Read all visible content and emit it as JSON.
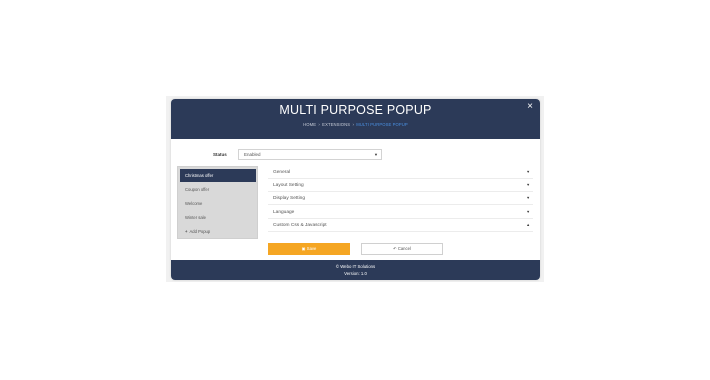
{
  "header": {
    "title": "MULTI PURPOSE POPUP",
    "breadcrumb": [
      "HOME",
      "EXTENSIONS",
      "MULTI PURPOSE POPUP"
    ],
    "close_icon": "×"
  },
  "status": {
    "label": "Status",
    "value": "Enabled",
    "arrow": "▼"
  },
  "sidebar": {
    "items": [
      {
        "label": "Christmas offer",
        "active": true
      },
      {
        "label": "Coupon offer",
        "active": false
      },
      {
        "label": "Welcome",
        "active": false
      },
      {
        "label": "Winter sale",
        "active": false
      }
    ],
    "add_label": "Add Popup",
    "add_icon": "+"
  },
  "accordion": {
    "items": [
      {
        "label": "General",
        "caret": "▼"
      },
      {
        "label": "Layout Setting",
        "caret": "▼"
      },
      {
        "label": "Display Setting",
        "caret": "▼"
      },
      {
        "label": "Language",
        "caret": "▼"
      },
      {
        "label": "Custom Css & Javascript",
        "caret": "▲"
      }
    ]
  },
  "buttons": {
    "save_label": "Save",
    "save_icon": "save-icon",
    "cancel_label": "Cancel",
    "cancel_icon": "reply-icon"
  },
  "footer": {
    "line1": "© Webo IT Solutions",
    "line2": "Version: 1.0"
  },
  "colors": {
    "primary": "#2c3a58",
    "accent": "#f5a623",
    "link": "#4a90e2"
  }
}
